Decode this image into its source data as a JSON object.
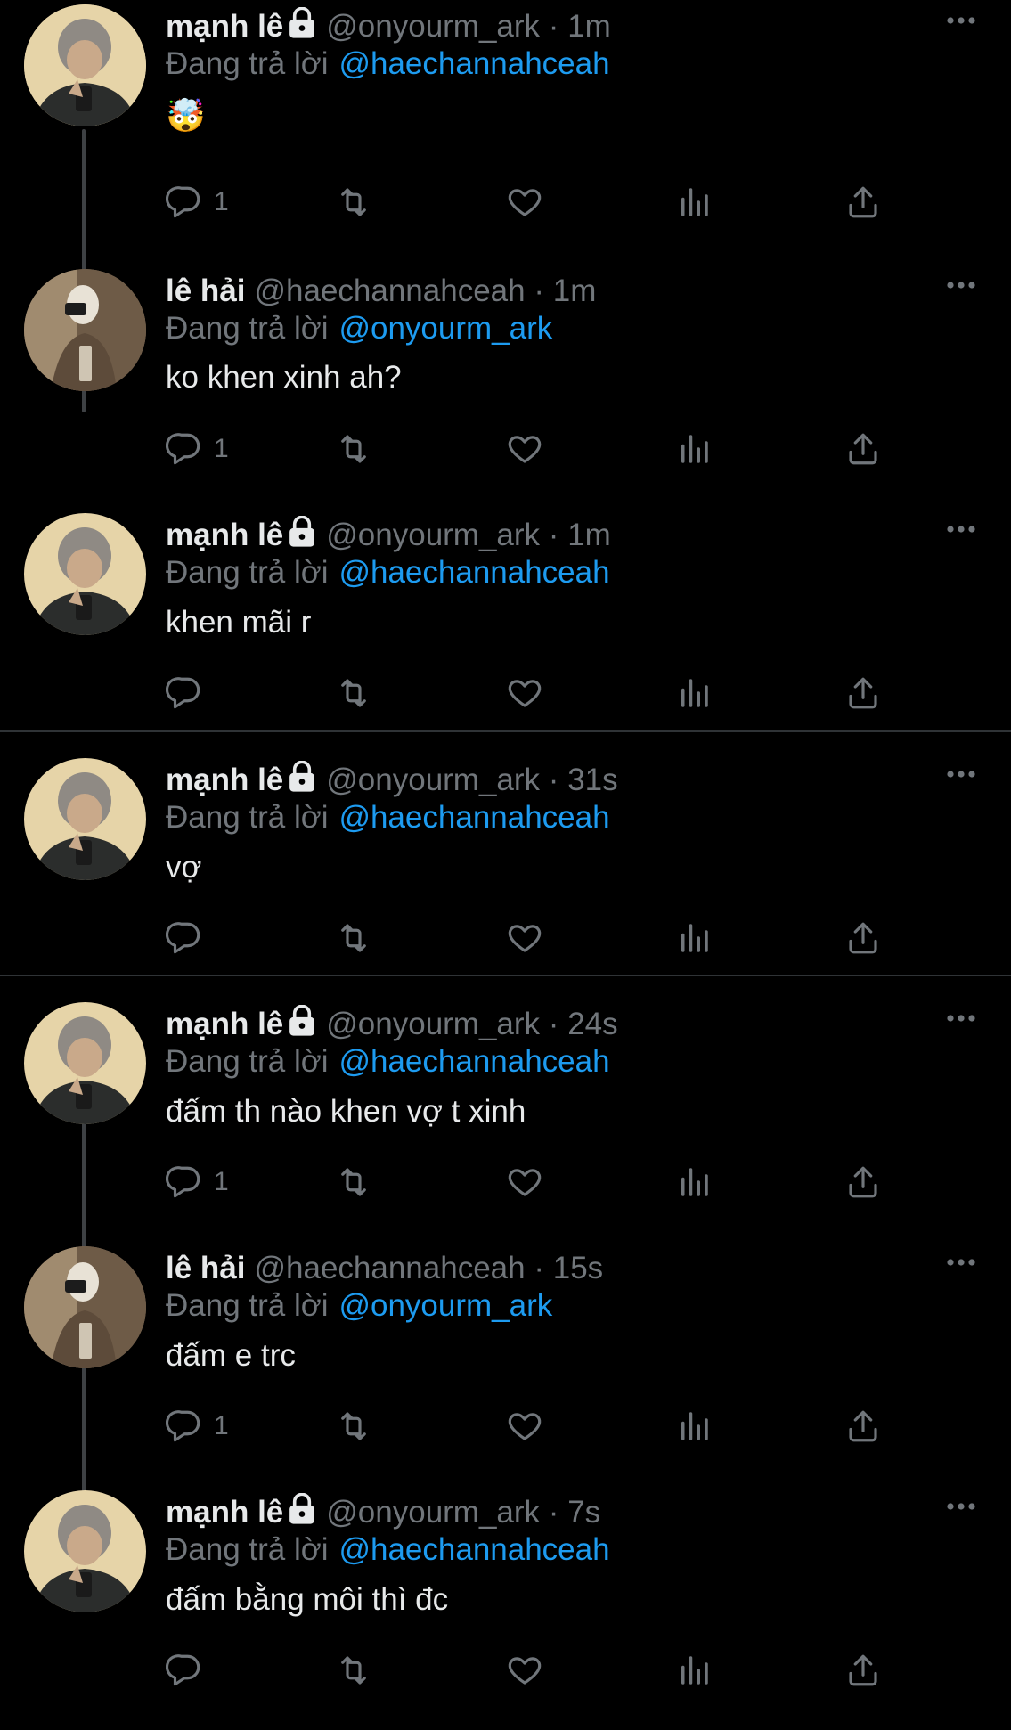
{
  "colors": {
    "background": "#000000",
    "text": "#e7e9ea",
    "muted": "#71767b",
    "link": "#1d9bf0",
    "divider": "#2f3336"
  },
  "reply_prefix": "Đang trả lời",
  "separator": "·",
  "tweets": [
    {
      "display_name": "mạnh lê",
      "handle": "@onyourm_ark",
      "time": "1m",
      "reply_to": "@haechannahceah",
      "text": "🤯",
      "reply_count": "1",
      "protected": true,
      "avatar": "avatar-manh"
    },
    {
      "display_name": "lê hải",
      "handle": "@haechannahceah",
      "time": "1m",
      "reply_to": "@onyourm_ark",
      "text": "ko khen xinh ah?",
      "reply_count": "1",
      "protected": false,
      "avatar": "avatar-hai"
    },
    {
      "display_name": "mạnh lê",
      "handle": "@onyourm_ark",
      "time": "1m",
      "reply_to": "@haechannahceah",
      "text": "khen mãi r",
      "reply_count": "",
      "protected": true,
      "avatar": "avatar-manh"
    },
    {
      "display_name": "mạnh lê",
      "handle": "@onyourm_ark",
      "time": "31s",
      "reply_to": "@haechannahceah",
      "text": "vợ",
      "reply_count": "",
      "protected": true,
      "avatar": "avatar-manh"
    },
    {
      "display_name": "mạnh lê",
      "handle": "@onyourm_ark",
      "time": "24s",
      "reply_to": "@haechannahceah",
      "text": "đấm th nào khen vợ t xinh",
      "reply_count": "1",
      "protected": true,
      "avatar": "avatar-manh"
    },
    {
      "display_name": "lê hải",
      "handle": "@haechannahceah",
      "time": "15s",
      "reply_to": "@onyourm_ark",
      "text": "đấm e trc",
      "reply_count": "1",
      "protected": false,
      "avatar": "avatar-hai"
    },
    {
      "display_name": "mạnh lê",
      "handle": "@onyourm_ark",
      "time": "7s",
      "reply_to": "@haechannahceah",
      "text": "đấm bằng môi thì đc",
      "reply_count": "",
      "protected": true,
      "avatar": "avatar-manh"
    }
  ],
  "icons": {
    "reply": "reply-icon",
    "retweet": "retweet-icon",
    "like": "heart-icon",
    "views": "views-icon",
    "share": "share-icon",
    "more": "more-icon",
    "lock": "lock-icon"
  }
}
